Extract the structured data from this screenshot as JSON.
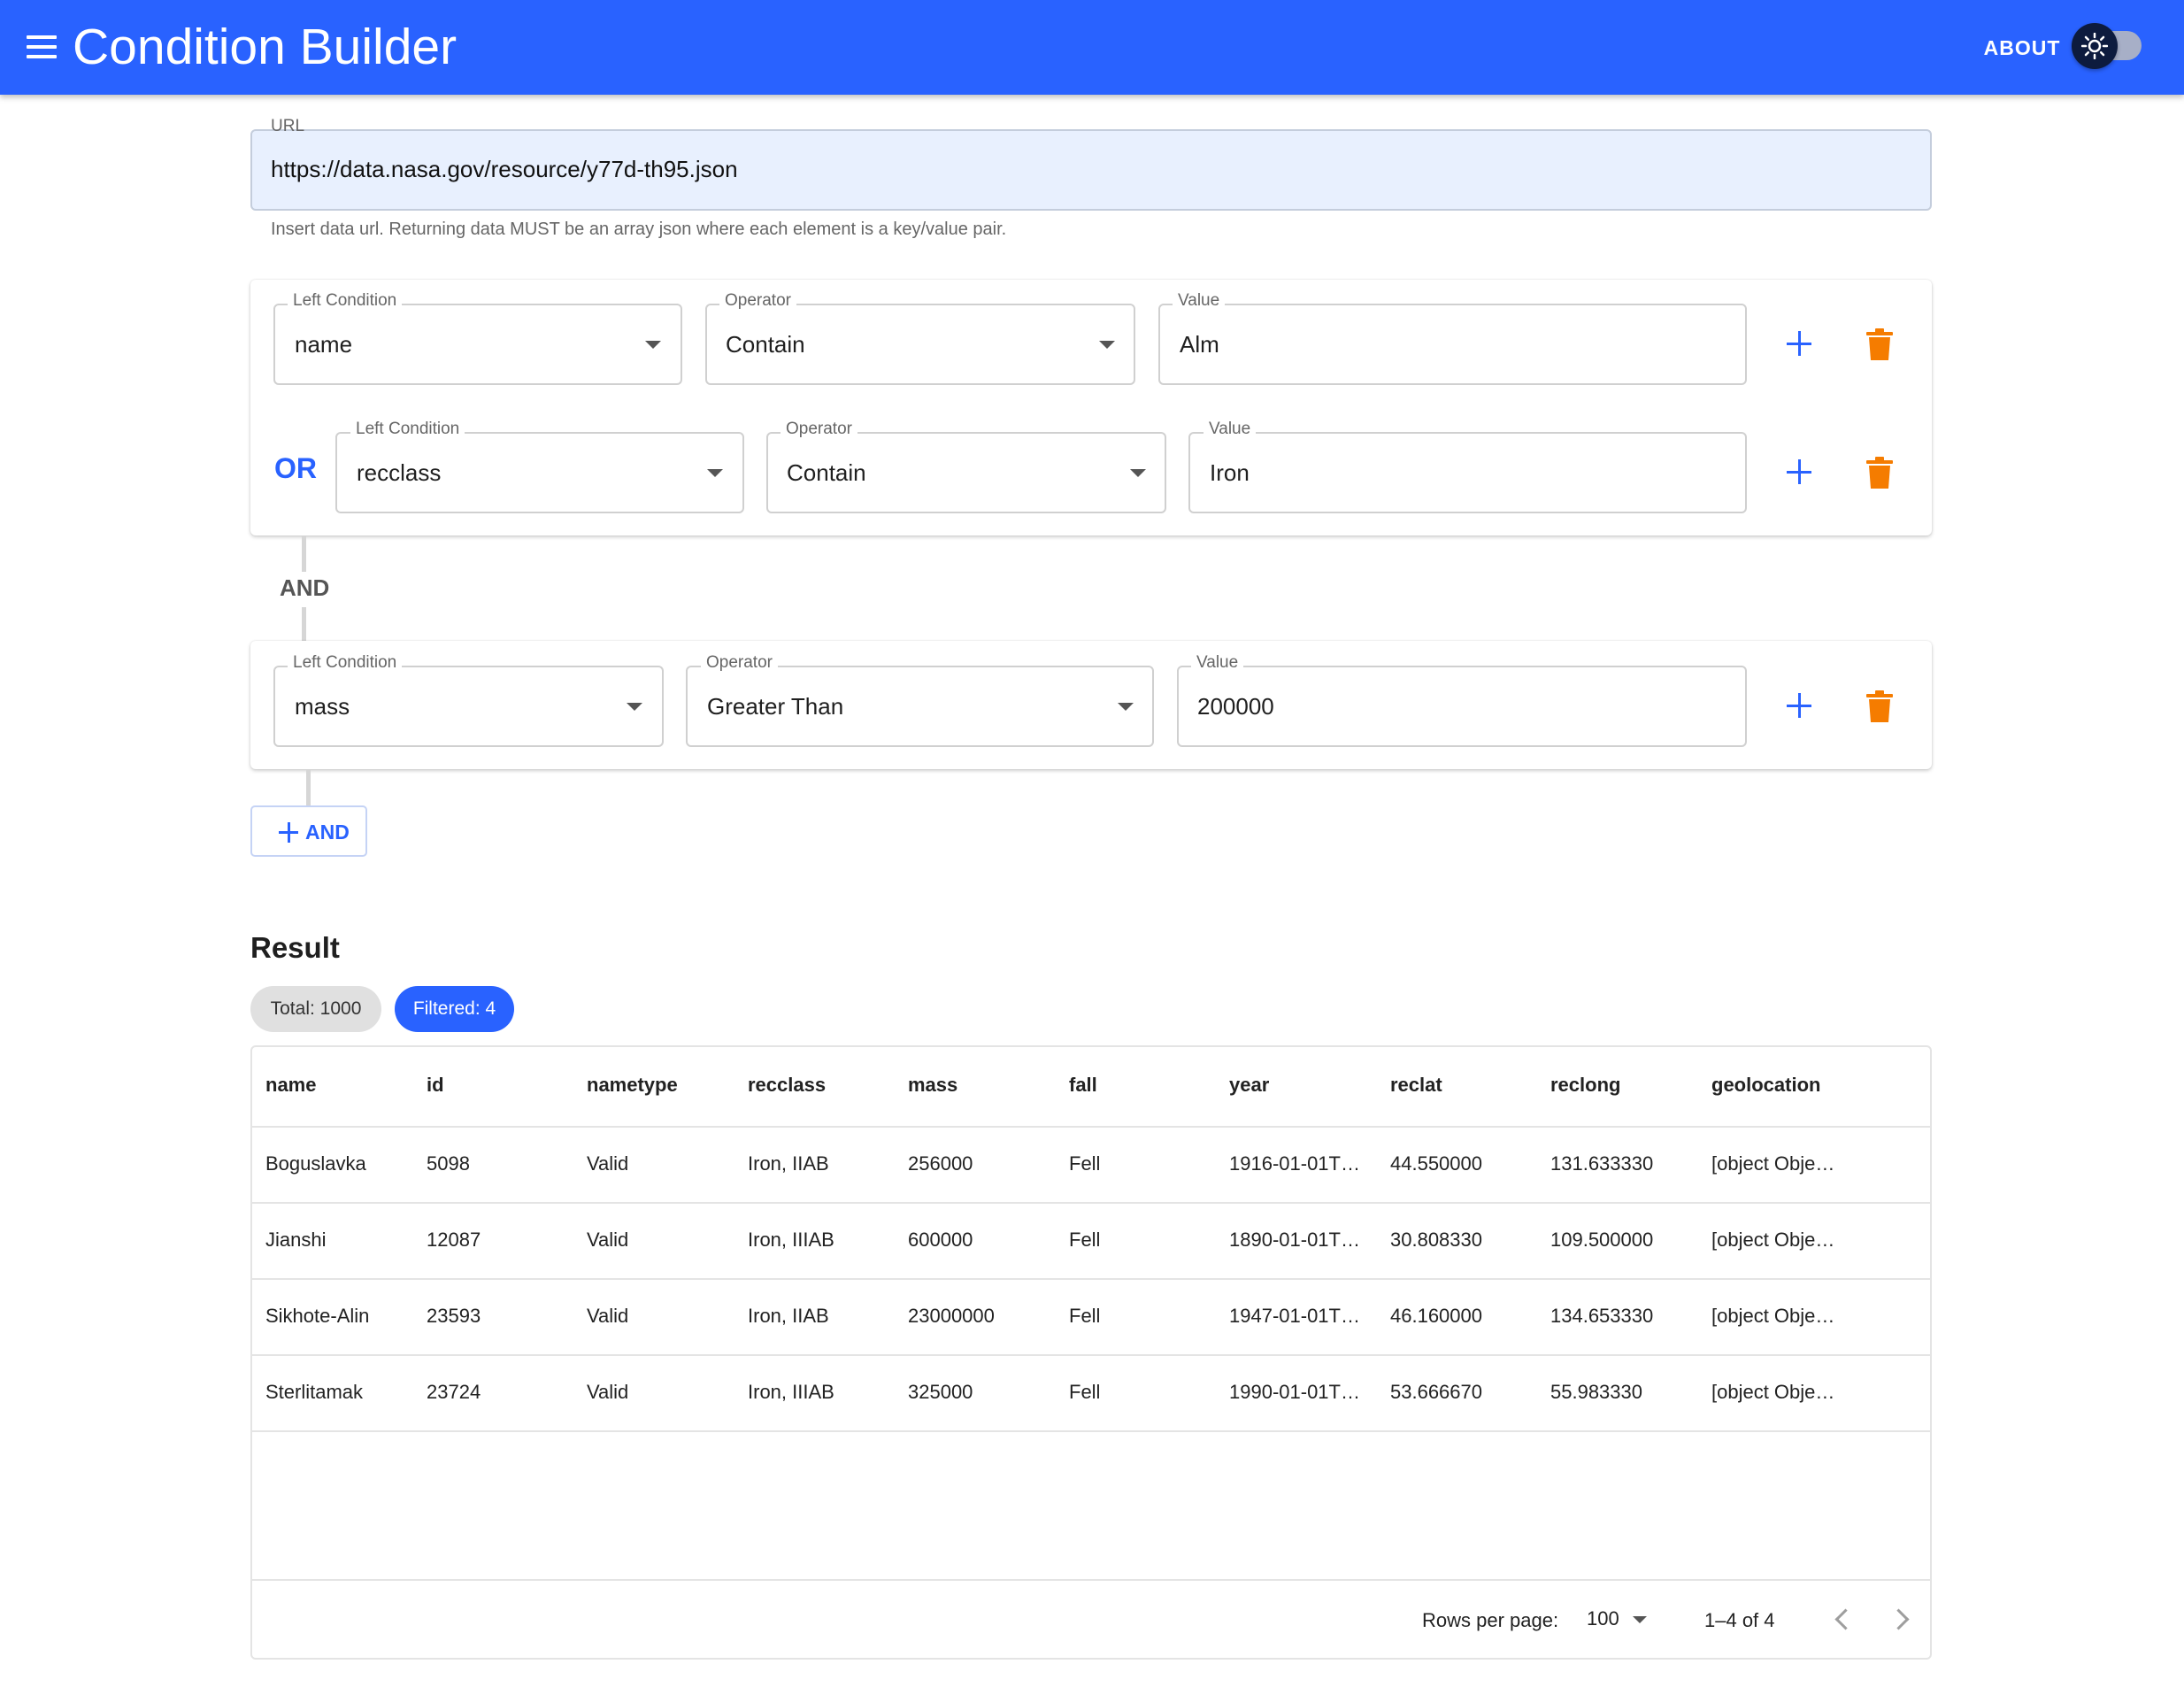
{
  "app": {
    "title": "Condition Builder",
    "about_label": "ABOUT",
    "theme_icon": "sun-icon"
  },
  "url": {
    "label": "URL",
    "value": "https://data.nasa.gov/resource/y77d-th95.json",
    "helper": "Insert data url. Returning data MUST be an array json where each element is a key/value pair."
  },
  "groups": [
    {
      "conditions": [
        {
          "left_label": "Left Condition",
          "left": "name",
          "op_label": "Operator",
          "op": "Contain",
          "value_label": "Value",
          "value": "Alm"
        },
        {
          "prefix": "OR",
          "left_label": "Left Condition",
          "left": "recclass",
          "op_label": "Operator",
          "op": "Contain",
          "value_label": "Value",
          "value": "Iron"
        }
      ]
    },
    {
      "conditions": [
        {
          "left_label": "Left Condition",
          "left": "mass",
          "op_label": "Operator",
          "op": "Greater Than",
          "value_label": "Value",
          "value": "200000"
        }
      ]
    }
  ],
  "connector_label": "AND",
  "add_and_label": "AND",
  "result": {
    "title": "Result",
    "total_chip": "Total: 1000",
    "filtered_chip": "Filtered: 4",
    "columns": [
      "name",
      "id",
      "nametype",
      "recclass",
      "mass",
      "fall",
      "year",
      "reclat",
      "reclong",
      "geolocation"
    ],
    "rows": [
      [
        "Boguslavka",
        "5098",
        "Valid",
        "Iron, IIAB",
        "256000",
        "Fell",
        "1916-01-01T…",
        "44.550000",
        "131.633330",
        "[object Obje…"
      ],
      [
        "Jianshi",
        "12087",
        "Valid",
        "Iron, IIIAB",
        "600000",
        "Fell",
        "1890-01-01T…",
        "30.808330",
        "109.500000",
        "[object Obje…"
      ],
      [
        "Sikhote-Alin",
        "23593",
        "Valid",
        "Iron, IIAB",
        "23000000",
        "Fell",
        "1947-01-01T…",
        "46.160000",
        "134.653330",
        "[object Obje…"
      ],
      [
        "Sterlitamak",
        "23724",
        "Valid",
        "Iron, IIIAB",
        "325000",
        "Fell",
        "1990-01-01T…",
        "53.666670",
        "55.983330",
        "[object Obje…"
      ]
    ],
    "rows_per_page_label": "Rows per page:",
    "rows_per_page": "100",
    "range": "1–4 of 4"
  },
  "colors": {
    "primary": "#2962ff",
    "danger": "#f57c00",
    "url_bg": "#e8f0fe"
  }
}
